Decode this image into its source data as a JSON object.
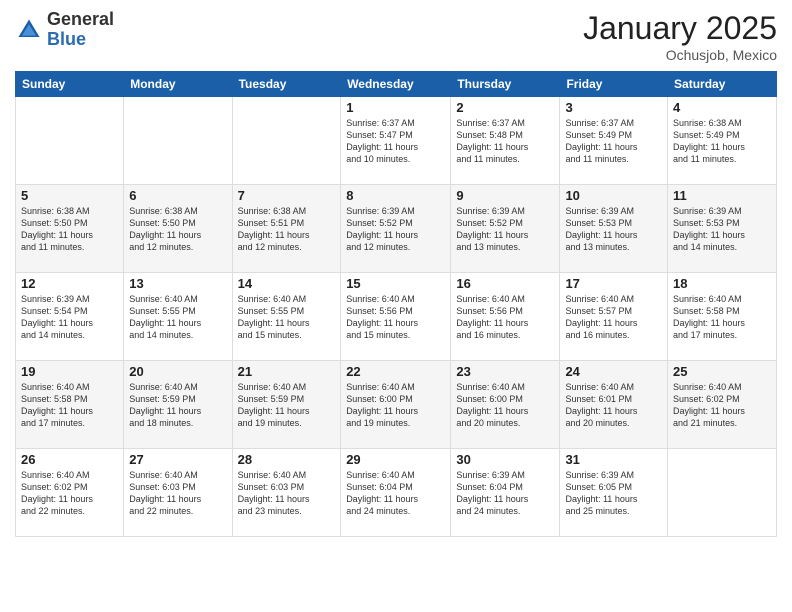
{
  "logo": {
    "general": "General",
    "blue": "Blue"
  },
  "header": {
    "month": "January 2025",
    "location": "Ochusjob, Mexico"
  },
  "weekdays": [
    "Sunday",
    "Monday",
    "Tuesday",
    "Wednesday",
    "Thursday",
    "Friday",
    "Saturday"
  ],
  "weeks": [
    [
      {
        "day": "",
        "info": ""
      },
      {
        "day": "",
        "info": ""
      },
      {
        "day": "",
        "info": ""
      },
      {
        "day": "1",
        "info": "Sunrise: 6:37 AM\nSunset: 5:47 PM\nDaylight: 11 hours\nand 10 minutes."
      },
      {
        "day": "2",
        "info": "Sunrise: 6:37 AM\nSunset: 5:48 PM\nDaylight: 11 hours\nand 11 minutes."
      },
      {
        "day": "3",
        "info": "Sunrise: 6:37 AM\nSunset: 5:49 PM\nDaylight: 11 hours\nand 11 minutes."
      },
      {
        "day": "4",
        "info": "Sunrise: 6:38 AM\nSunset: 5:49 PM\nDaylight: 11 hours\nand 11 minutes."
      }
    ],
    [
      {
        "day": "5",
        "info": "Sunrise: 6:38 AM\nSunset: 5:50 PM\nDaylight: 11 hours\nand 11 minutes."
      },
      {
        "day": "6",
        "info": "Sunrise: 6:38 AM\nSunset: 5:50 PM\nDaylight: 11 hours\nand 12 minutes."
      },
      {
        "day": "7",
        "info": "Sunrise: 6:38 AM\nSunset: 5:51 PM\nDaylight: 11 hours\nand 12 minutes."
      },
      {
        "day": "8",
        "info": "Sunrise: 6:39 AM\nSunset: 5:52 PM\nDaylight: 11 hours\nand 12 minutes."
      },
      {
        "day": "9",
        "info": "Sunrise: 6:39 AM\nSunset: 5:52 PM\nDaylight: 11 hours\nand 13 minutes."
      },
      {
        "day": "10",
        "info": "Sunrise: 6:39 AM\nSunset: 5:53 PM\nDaylight: 11 hours\nand 13 minutes."
      },
      {
        "day": "11",
        "info": "Sunrise: 6:39 AM\nSunset: 5:53 PM\nDaylight: 11 hours\nand 14 minutes."
      }
    ],
    [
      {
        "day": "12",
        "info": "Sunrise: 6:39 AM\nSunset: 5:54 PM\nDaylight: 11 hours\nand 14 minutes."
      },
      {
        "day": "13",
        "info": "Sunrise: 6:40 AM\nSunset: 5:55 PM\nDaylight: 11 hours\nand 14 minutes."
      },
      {
        "day": "14",
        "info": "Sunrise: 6:40 AM\nSunset: 5:55 PM\nDaylight: 11 hours\nand 15 minutes."
      },
      {
        "day": "15",
        "info": "Sunrise: 6:40 AM\nSunset: 5:56 PM\nDaylight: 11 hours\nand 15 minutes."
      },
      {
        "day": "16",
        "info": "Sunrise: 6:40 AM\nSunset: 5:56 PM\nDaylight: 11 hours\nand 16 minutes."
      },
      {
        "day": "17",
        "info": "Sunrise: 6:40 AM\nSunset: 5:57 PM\nDaylight: 11 hours\nand 16 minutes."
      },
      {
        "day": "18",
        "info": "Sunrise: 6:40 AM\nSunset: 5:58 PM\nDaylight: 11 hours\nand 17 minutes."
      }
    ],
    [
      {
        "day": "19",
        "info": "Sunrise: 6:40 AM\nSunset: 5:58 PM\nDaylight: 11 hours\nand 17 minutes."
      },
      {
        "day": "20",
        "info": "Sunrise: 6:40 AM\nSunset: 5:59 PM\nDaylight: 11 hours\nand 18 minutes."
      },
      {
        "day": "21",
        "info": "Sunrise: 6:40 AM\nSunset: 5:59 PM\nDaylight: 11 hours\nand 19 minutes."
      },
      {
        "day": "22",
        "info": "Sunrise: 6:40 AM\nSunset: 6:00 PM\nDaylight: 11 hours\nand 19 minutes."
      },
      {
        "day": "23",
        "info": "Sunrise: 6:40 AM\nSunset: 6:00 PM\nDaylight: 11 hours\nand 20 minutes."
      },
      {
        "day": "24",
        "info": "Sunrise: 6:40 AM\nSunset: 6:01 PM\nDaylight: 11 hours\nand 20 minutes."
      },
      {
        "day": "25",
        "info": "Sunrise: 6:40 AM\nSunset: 6:02 PM\nDaylight: 11 hours\nand 21 minutes."
      }
    ],
    [
      {
        "day": "26",
        "info": "Sunrise: 6:40 AM\nSunset: 6:02 PM\nDaylight: 11 hours\nand 22 minutes."
      },
      {
        "day": "27",
        "info": "Sunrise: 6:40 AM\nSunset: 6:03 PM\nDaylight: 11 hours\nand 22 minutes."
      },
      {
        "day": "28",
        "info": "Sunrise: 6:40 AM\nSunset: 6:03 PM\nDaylight: 11 hours\nand 23 minutes."
      },
      {
        "day": "29",
        "info": "Sunrise: 6:40 AM\nSunset: 6:04 PM\nDaylight: 11 hours\nand 24 minutes."
      },
      {
        "day": "30",
        "info": "Sunrise: 6:39 AM\nSunset: 6:04 PM\nDaylight: 11 hours\nand 24 minutes."
      },
      {
        "day": "31",
        "info": "Sunrise: 6:39 AM\nSunset: 6:05 PM\nDaylight: 11 hours\nand 25 minutes."
      },
      {
        "day": "",
        "info": ""
      }
    ]
  ]
}
